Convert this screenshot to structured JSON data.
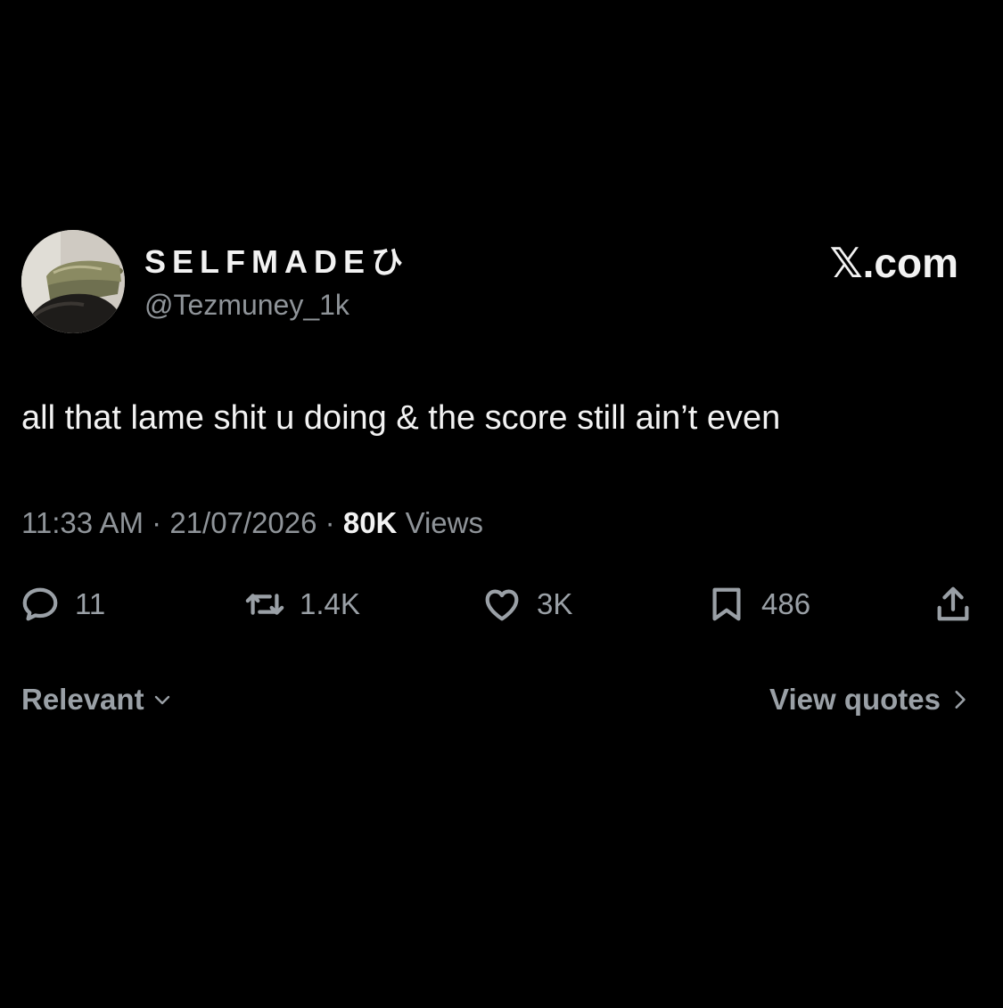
{
  "post": {
    "display_name": "SELFMADEひ",
    "handle": "@Tezmuney_1k",
    "brand": "𝕏.com",
    "text": "all that lame shit u doing & the score still ain’t even",
    "time": "11:33 AM",
    "separator": "·",
    "date": "21/07/2026",
    "views_count": "80K",
    "views_label": "Views"
  },
  "actions": {
    "replies": "11",
    "reposts": "1.4K",
    "likes": "3K",
    "bookmarks": "486"
  },
  "footer": {
    "sort_label": "Relevant",
    "quotes_label": "View quotes"
  },
  "colors": {
    "background": "#000000",
    "primary_text": "#f2f2f2",
    "secondary_text": "#8f9499",
    "icon": "#9aa0a6"
  },
  "icons": {
    "reply": "reply-icon",
    "repost": "repost-icon",
    "like": "heart-icon",
    "bookmark": "bookmark-icon",
    "share": "share-icon",
    "chevron_down": "chevron-down-icon",
    "chevron_right": "chevron-right-icon"
  }
}
